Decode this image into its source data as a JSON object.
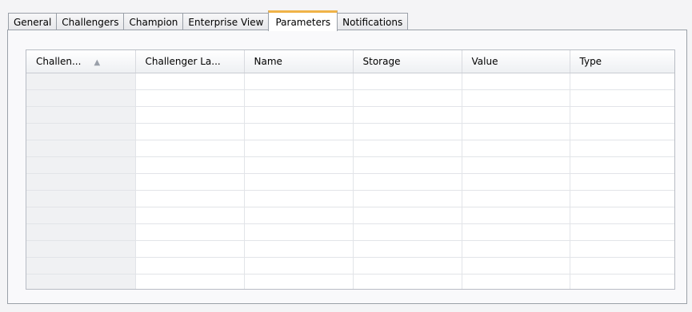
{
  "tabs": [
    {
      "label": "General",
      "active": false
    },
    {
      "label": "Challengers",
      "active": false
    },
    {
      "label": "Champion",
      "active": false
    },
    {
      "label": "Enterprise View",
      "active": false
    },
    {
      "label": "Parameters",
      "active": true
    },
    {
      "label": "Notifications",
      "active": false
    }
  ],
  "table": {
    "columns": [
      {
        "label": "Challen...",
        "sorted": "ascending"
      },
      {
        "label": "Challenger La..."
      },
      {
        "label": "Name"
      },
      {
        "label": "Storage"
      },
      {
        "label": "Value"
      },
      {
        "label": "Type"
      }
    ],
    "sort_icon": "sort-ascending-icon",
    "rows": []
  },
  "colors": {
    "active_tab_accent": "#f0b348",
    "border": "#9aa0a8",
    "first_column_bg": "#f0f1f3"
  }
}
